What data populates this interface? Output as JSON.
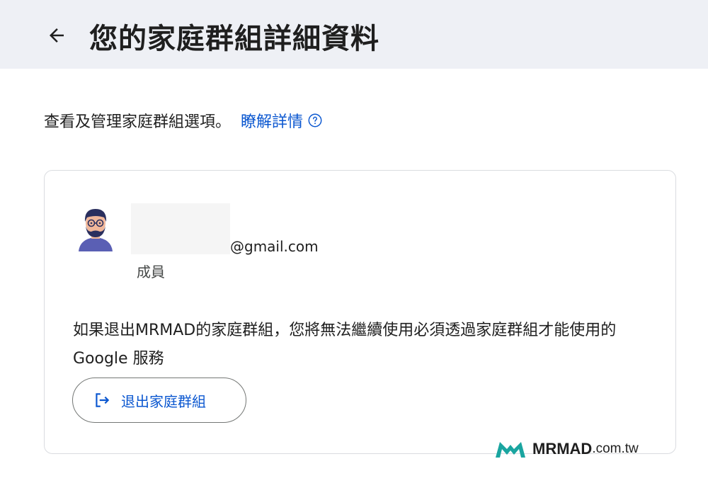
{
  "header": {
    "title": "您的家庭群組詳細資料",
    "back_icon": "arrow-left-icon"
  },
  "intro": {
    "text": "查看及管理家庭群組選項。",
    "link_label": "瞭解詳情",
    "help_icon": "help-circle-icon"
  },
  "member": {
    "avatar_icon": "avatar-icon",
    "email_suffix": "@gmail.com",
    "role": "成員"
  },
  "warning_text": "如果退出MRMAD的家庭群組，您將無法繼續使用必須透過家庭群組才能使用的 Google 服務",
  "leave_button": {
    "label": "退出家庭群組",
    "icon": "logout-icon"
  },
  "watermark": {
    "brand": "MRMAD",
    "domain": ".com.tw",
    "logo_color": "#1aa5a0"
  },
  "colors": {
    "header_bg": "#eef0f5",
    "link": "#0b57d0",
    "text": "#1f1f1f"
  }
}
